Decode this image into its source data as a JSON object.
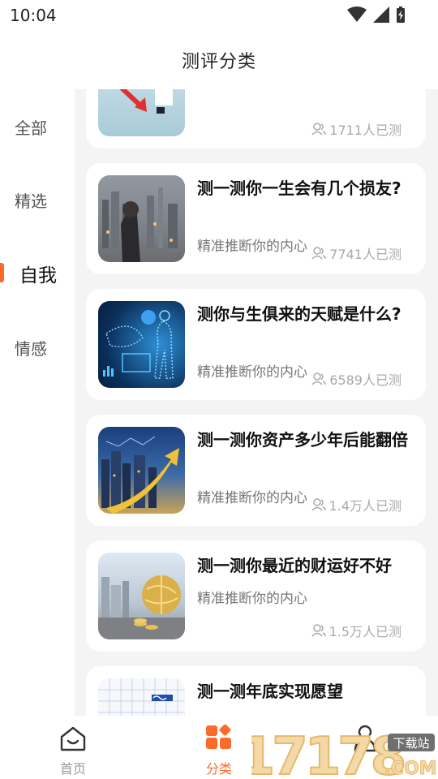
{
  "status_bar": {
    "time": "10:04"
  },
  "header": {
    "title": "测评分类"
  },
  "sidebar": {
    "items": [
      {
        "label": "全部"
      },
      {
        "label": "精选"
      },
      {
        "label": "自我",
        "active": true
      },
      {
        "label": "情感"
      }
    ]
  },
  "cards": [
    {
      "title": "",
      "subtitle": "",
      "count": "1711人已测"
    },
    {
      "title": "测一测你一生会有几个损友?",
      "subtitle": "精准推断你的内心",
      "count": "7741人已测"
    },
    {
      "title": "测你与生俱来的天赋是什么?",
      "subtitle": "精准推断你的内心",
      "count": "6589人已测"
    },
    {
      "title": "测一测你资产多少年后能翻倍",
      "subtitle": "精准推断你的内心",
      "count": "1.4万人已测"
    },
    {
      "title": "测一测你最近的财运好不好",
      "subtitle": "精准推断你的内心",
      "count": "1.5万人已测"
    },
    {
      "title": "测一测年底实现愿望",
      "subtitle": "",
      "count": ""
    }
  ],
  "bottom_nav": {
    "items": [
      {
        "label": "首页",
        "icon": "home-icon"
      },
      {
        "label": "分类",
        "icon": "category-icon",
        "active": true
      },
      {
        "label": "",
        "icon": "profile-icon"
      }
    ]
  },
  "watermark": {
    "text": "17178",
    "badge": "下载站",
    "domain": ".COM"
  },
  "colors": {
    "accent": "#ff6a2a",
    "background": "#f4f4f4"
  }
}
